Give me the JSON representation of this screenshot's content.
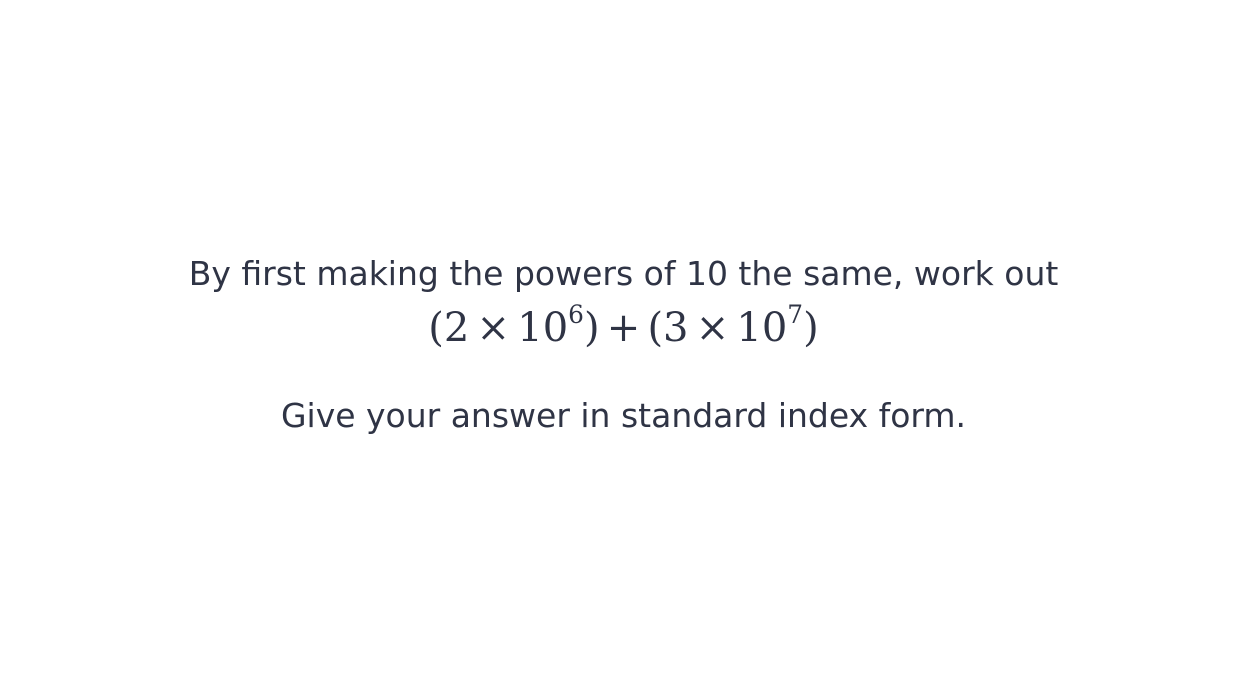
{
  "question": {
    "prompt": "By first making the powers of 10 the same, work out",
    "expression": {
      "open1": "(",
      "coef1": "2",
      "times1": "×",
      "base1": "10",
      "exp1": "6",
      "close1": ")",
      "plus": "+",
      "open2": "(",
      "coef2": "3",
      "times2": "×",
      "base2": "10",
      "exp2": "7",
      "close2": ")"
    },
    "instruction": "Give your answer in standard index form."
  },
  "colors": {
    "text": "#2f3445",
    "background": "#ffffff"
  }
}
